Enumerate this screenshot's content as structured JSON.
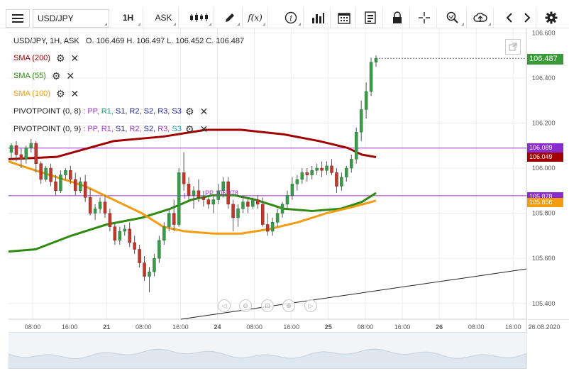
{
  "toolbar": {
    "menu_icon": "hamburger-menu-icon",
    "symbol": "USD/JPY",
    "timeframe": "1H",
    "price_type": "ASK",
    "fx_label": "f(x)"
  },
  "header": {
    "info_line": "USD/JPY, 1H, ASK   O. 106.469 H. 106.497 L. 106.452 C. 106.487"
  },
  "legend": [
    {
      "label": "SMA (200)",
      "color": "#a00000"
    },
    {
      "label": "SMA (55)",
      "color": "#2e8b10"
    },
    {
      "label": "SMA (100)",
      "color": "#f39c12"
    }
  ],
  "pivots": [
    {
      "label": "PIVOTPOINT (0, 8)",
      "items": [
        ": PP,",
        "R1,",
        "S1,",
        "R2,",
        "S2,",
        "R3,",
        "S3"
      ],
      "colors": [
        "#9b30d0",
        "#1a9a70",
        "#1a1a9a",
        "#1a1a9a",
        "#1a1a9a",
        "#1a1a9a",
        "#1a1a9a"
      ]
    },
    {
      "label": "PIVOTPOINT (0, 9)",
      "items": [
        ": PP,",
        "R1,",
        "S1,",
        "R2,",
        "S2,",
        "R3,",
        "S3"
      ],
      "colors": [
        "#9b30d0",
        "#9b30d0",
        "#1a1a9a",
        "#9b30d0",
        "#1a1a9a",
        "#9b30d0",
        "#1a9a9a"
      ]
    }
  ],
  "price_axis": {
    "ticks": [
      "106.600",
      "106.400",
      "106.200",
      "106.000",
      "105.800",
      "105.600",
      "105.400"
    ],
    "badges": [
      {
        "value": "106.487",
        "color": "#3a9a3a"
      },
      {
        "value": "106.089",
        "color": "#8a2bd0"
      },
      {
        "value": "106.049",
        "color": "#a00000"
      },
      {
        "value": "105.878",
        "color": "#8a2bd0"
      },
      {
        "value": "105.856",
        "color": "#f39c12"
      }
    ]
  },
  "pp_label": "PP 105.878",
  "time_axis": {
    "labels": [
      "08:00",
      "16:00",
      "21",
      "08:00",
      "16:00",
      "24",
      "08:00",
      "16:00",
      "25",
      "08:00",
      "16:00",
      "26",
      "08:00",
      "16:00",
      "26.08.2020"
    ]
  },
  "chart_data": {
    "type": "candlestick",
    "symbol": "USD/JPY",
    "timeframe": "1H",
    "ylim": [
      105.33,
      106.62
    ],
    "last_price": 106.487,
    "candles": [
      [
        106.07,
        106.11,
        106.04,
        106.1
      ],
      [
        106.1,
        106.12,
        106.03,
        106.06
      ],
      [
        106.06,
        106.09,
        106.0,
        106.04
      ],
      [
        106.04,
        106.1,
        106.02,
        106.09
      ],
      [
        106.09,
        106.13,
        106.07,
        106.11
      ],
      [
        106.11,
        106.12,
        105.98,
        106.02
      ],
      [
        106.02,
        106.03,
        105.93,
        105.95
      ],
      [
        105.95,
        106.01,
        105.94,
        106.0
      ],
      [
        106.0,
        106.02,
        105.92,
        105.94
      ],
      [
        105.94,
        105.97,
        105.88,
        105.9
      ],
      [
        105.9,
        105.99,
        105.89,
        105.97
      ],
      [
        105.97,
        106.0,
        105.95,
        105.99
      ],
      [
        105.99,
        106.01,
        105.93,
        105.95
      ],
      [
        105.95,
        105.98,
        105.88,
        105.9
      ],
      [
        105.9,
        105.96,
        105.89,
        105.94
      ],
      [
        105.94,
        105.97,
        105.85,
        105.87
      ],
      [
        105.87,
        105.91,
        105.79,
        105.8
      ],
      [
        105.8,
        105.84,
        105.77,
        105.82
      ],
      [
        105.82,
        105.87,
        105.8,
        105.85
      ],
      [
        105.85,
        105.88,
        105.78,
        105.8
      ],
      [
        105.8,
        105.82,
        105.72,
        105.74
      ],
      [
        105.74,
        105.76,
        105.66,
        105.68
      ],
      [
        105.68,
        105.74,
        105.66,
        105.72
      ],
      [
        105.72,
        105.75,
        105.7,
        105.73
      ],
      [
        105.73,
        105.76,
        105.65,
        105.67
      ],
      [
        105.67,
        105.7,
        105.62,
        105.64
      ],
      [
        105.64,
        105.66,
        105.56,
        105.58
      ],
      [
        105.58,
        105.61,
        105.5,
        105.52
      ],
      [
        105.52,
        105.56,
        105.45,
        105.54
      ],
      [
        105.54,
        105.62,
        105.52,
        105.6
      ],
      [
        105.6,
        105.7,
        105.58,
        105.68
      ],
      [
        105.68,
        105.76,
        105.66,
        105.74
      ],
      [
        105.74,
        105.82,
        105.72,
        105.8
      ],
      [
        105.8,
        105.86,
        105.72,
        105.75
      ],
      [
        105.75,
        106.0,
        105.74,
        105.98
      ],
      [
        105.98,
        106.07,
        105.9,
        105.93
      ],
      [
        105.93,
        105.96,
        105.86,
        105.88
      ],
      [
        105.88,
        105.92,
        105.82,
        105.9
      ],
      [
        105.9,
        105.95,
        105.85,
        105.87
      ],
      [
        105.87,
        105.9,
        105.83,
        105.86
      ],
      [
        105.86,
        105.88,
        105.82,
        105.84
      ],
      [
        105.84,
        105.88,
        105.8,
        105.86
      ],
      [
        105.86,
        105.93,
        105.84,
        105.9
      ],
      [
        105.9,
        105.96,
        105.87,
        105.94
      ],
      [
        105.94,
        105.96,
        105.82,
        105.84
      ],
      [
        105.84,
        105.86,
        105.72,
        105.78
      ],
      [
        105.78,
        105.84,
        105.74,
        105.82
      ],
      [
        105.82,
        105.88,
        105.8,
        105.85
      ],
      [
        105.85,
        105.87,
        105.8,
        105.83
      ],
      [
        105.83,
        105.87,
        105.82,
        105.86
      ],
      [
        105.86,
        105.88,
        105.82,
        105.84
      ],
      [
        105.84,
        105.87,
        105.74,
        105.75
      ],
      [
        105.75,
        105.8,
        105.7,
        105.72
      ],
      [
        105.72,
        105.78,
        105.7,
        105.76
      ],
      [
        105.76,
        105.82,
        105.74,
        105.8
      ],
      [
        105.8,
        105.85,
        105.78,
        105.84
      ],
      [
        105.84,
        105.9,
        105.82,
        105.88
      ],
      [
        105.88,
        105.96,
        105.86,
        105.93
      ],
      [
        105.93,
        105.97,
        105.9,
        105.95
      ],
      [
        105.95,
        106.0,
        105.93,
        105.98
      ],
      [
        105.98,
        106.0,
        105.94,
        105.97
      ],
      [
        105.97,
        106.01,
        105.95,
        105.99
      ],
      [
        105.99,
        106.02,
        105.97,
        106.0
      ],
      [
        106.0,
        106.03,
        105.96,
        105.99
      ],
      [
        105.99,
        106.03,
        105.97,
        106.01
      ],
      [
        106.01,
        106.04,
        105.97,
        105.98
      ],
      [
        105.98,
        106.0,
        105.89,
        105.92
      ],
      [
        105.92,
        105.98,
        105.9,
        105.96
      ],
      [
        105.96,
        106.01,
        105.94,
        106.0
      ],
      [
        106.0,
        106.06,
        105.98,
        106.04
      ],
      [
        106.04,
        106.18,
        106.02,
        106.16
      ],
      [
        106.16,
        106.3,
        106.12,
        106.26
      ],
      [
        106.26,
        106.38,
        106.22,
        106.34
      ],
      [
        106.34,
        106.49,
        106.32,
        106.47
      ],
      [
        106.47,
        106.5,
        106.45,
        106.487
      ]
    ],
    "sma": [
      {
        "name": "SMA (200)",
        "color": "#a00000"
      },
      {
        "name": "SMA (55)",
        "color": "#2e8b10"
      },
      {
        "name": "SMA (100)",
        "color": "#f39c12"
      }
    ],
    "levels": [
      {
        "value": 106.089,
        "color": "#9b30d0"
      },
      {
        "value": 105.878,
        "color": "#9b30d0"
      }
    ]
  }
}
